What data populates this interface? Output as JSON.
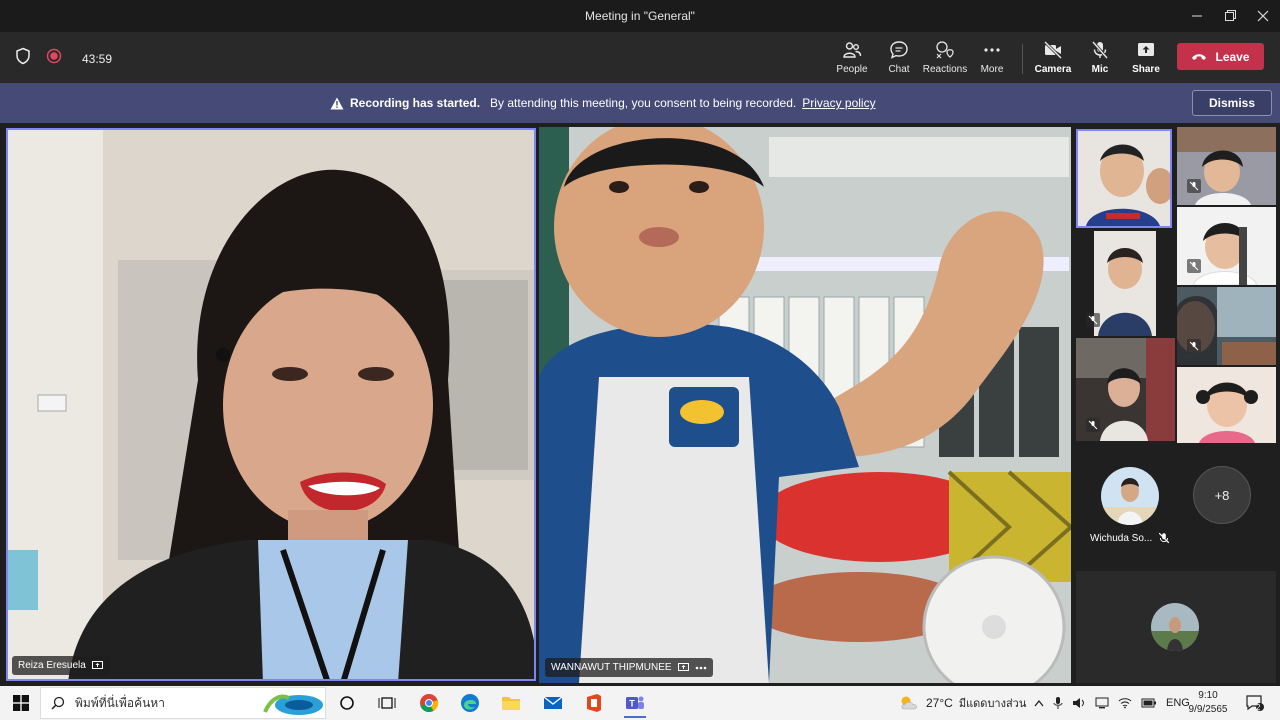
{
  "window": {
    "title": "Meeting in \"General\""
  },
  "toolbar": {
    "timer": "43:59",
    "buttons": {
      "people": "People",
      "chat": "Chat",
      "reactions": "Reactions",
      "more": "More",
      "camera": "Camera",
      "mic": "Mic",
      "share": "Share"
    },
    "leave": "Leave"
  },
  "banner": {
    "title": "Recording has started.",
    "message": "By attending this meeting, you consent to being recorded.",
    "link": "Privacy policy",
    "dismiss": "Dismiss"
  },
  "participants": {
    "main_left": "Reiza Eresuela",
    "main_right": "WANNAWUT THIPMUNEE",
    "named_thumb": "Wichuda So...",
    "overflow": "+8"
  },
  "taskbar": {
    "search_placeholder": "พิมพ์ที่นี่เพื่อค้นหา",
    "weather": "27°C",
    "weather_desc": "มีแดดบางส่วน",
    "lang": "ENG",
    "time": "9:10",
    "date": "9/9/2565",
    "notifications": "2"
  },
  "colors": {
    "accent": "#6264a7",
    "leave": "#c4314b",
    "banner": "#454a76",
    "record": "#e3475f"
  }
}
